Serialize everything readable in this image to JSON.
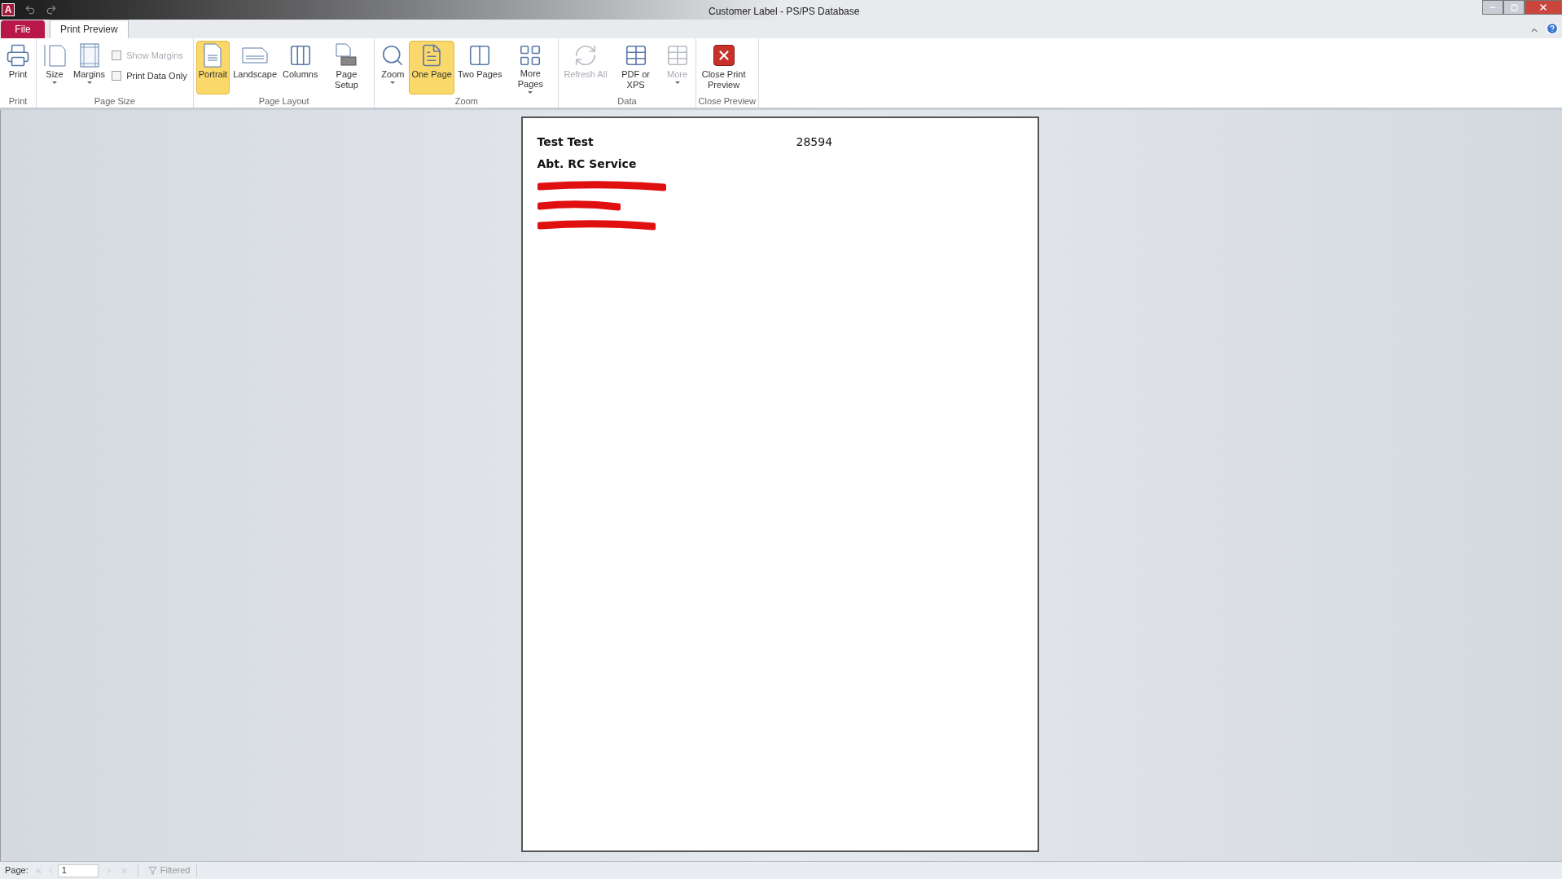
{
  "window": {
    "app_letter": "A",
    "title": "Customer Label  -  PS/PS Database"
  },
  "tabs": [
    {
      "label": "File",
      "kind": "file",
      "selected": false
    },
    {
      "label": "Print Preview",
      "kind": "ribbon",
      "selected": true
    }
  ],
  "ribbon": {
    "groups": [
      {
        "label": "Print",
        "items": [
          {
            "kind": "printer",
            "label": "Print",
            "selected": false,
            "disabled": false,
            "dropdown": false
          }
        ]
      },
      {
        "label": "Page Size",
        "items": [
          {
            "kind": "size",
            "label": "Size",
            "selected": false,
            "disabled": false,
            "dropdown": true
          },
          {
            "kind": "margins",
            "label": "Margins",
            "selected": false,
            "disabled": false,
            "dropdown": true
          },
          {
            "kind": "checks",
            "checks": [
              {
                "label": "Show Margins",
                "checked": false,
                "disabled": true
              },
              {
                "label": "Print Data Only",
                "checked": false,
                "disabled": false
              }
            ]
          }
        ]
      },
      {
        "label": "Page Layout",
        "items": [
          {
            "kind": "portrait",
            "label": "Portrait",
            "selected": true,
            "disabled": false,
            "dropdown": false
          },
          {
            "kind": "landscape",
            "label": "Landscape",
            "selected": false,
            "disabled": false,
            "dropdown": false
          },
          {
            "kind": "columns",
            "label": "Columns",
            "selected": false,
            "disabled": false,
            "dropdown": false
          },
          {
            "kind": "setup",
            "label": "Page Setup",
            "selected": false,
            "disabled": false,
            "dropdown": false
          }
        ]
      },
      {
        "label": "Zoom",
        "items": [
          {
            "kind": "zoom",
            "label": "Zoom",
            "selected": false,
            "disabled": false,
            "dropdown": true
          },
          {
            "kind": "onepage",
            "label": "One Page",
            "selected": true,
            "disabled": false,
            "dropdown": false
          },
          {
            "kind": "twopages",
            "label": "Two Pages",
            "selected": false,
            "disabled": false,
            "dropdown": false
          },
          {
            "kind": "morepages",
            "label": "More Pages",
            "selected": false,
            "disabled": false,
            "dropdown": true
          }
        ]
      },
      {
        "label": "Data",
        "items": [
          {
            "kind": "refresh",
            "label": "Refresh All",
            "selected": false,
            "disabled": true,
            "dropdown": false
          },
          {
            "kind": "pdf",
            "label": "PDF or XPS",
            "selected": false,
            "disabled": false,
            "dropdown": false
          },
          {
            "kind": "table",
            "label": "More",
            "selected": false,
            "disabled": true,
            "dropdown": true
          }
        ]
      },
      {
        "label": "Close Preview",
        "items": [
          {
            "kind": "close",
            "label": "Close Print Preview",
            "selected": false,
            "disabled": false,
            "dropdown": false
          }
        ]
      }
    ]
  },
  "label_page": {
    "name": "Test Test",
    "number": "28594",
    "department": "Abt. RC Service"
  },
  "status_bar": {
    "page_label": "Page:",
    "page_value": "1",
    "filter": "Filtered"
  }
}
